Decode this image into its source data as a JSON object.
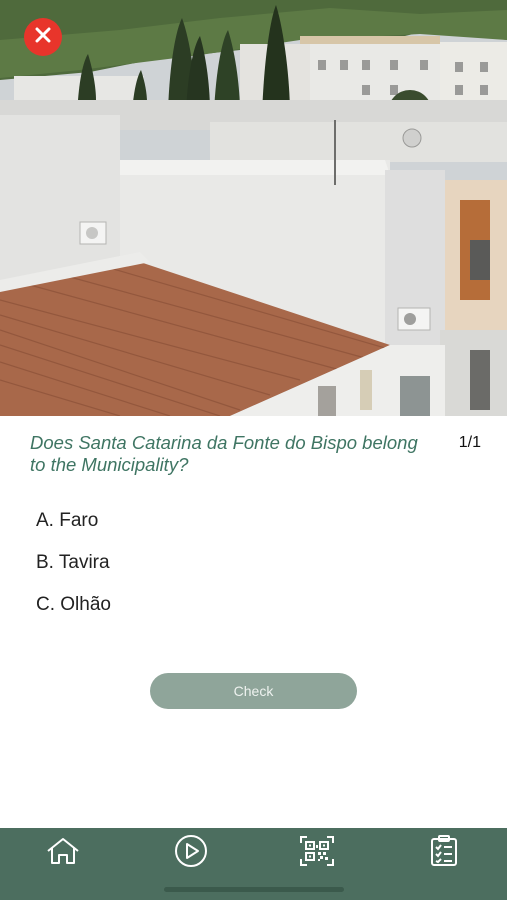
{
  "question": {
    "text": "Does Santa Catarina da Fonte do Bispo belong to the Municipality?",
    "counter": "1/1"
  },
  "answers": [
    {
      "label": "A. Faro"
    },
    {
      "label": "B. Tavira"
    },
    {
      "label": "C. Olhão"
    }
  ],
  "check_button": {
    "label": "Check"
  },
  "tabbar": {
    "items": [
      {
        "icon": "home-icon"
      },
      {
        "icon": "play-icon"
      },
      {
        "icon": "qr-code-icon"
      },
      {
        "icon": "checklist-icon"
      }
    ]
  },
  "colors": {
    "accent_green": "#4c6e5f",
    "question_text": "#3f7563",
    "close_red": "#e8352b",
    "check_button": "#8fa59a"
  }
}
